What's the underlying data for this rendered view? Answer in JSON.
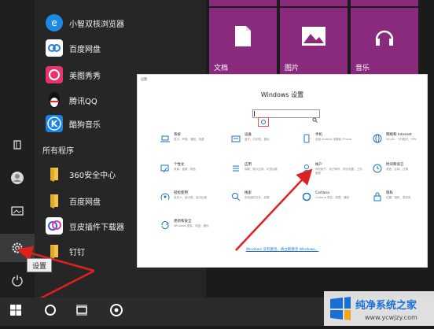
{
  "start_menu": {
    "apps_pinned": [
      {
        "label": "小智双核浏览器",
        "icon": "browser-icon",
        "color": "#1e88e5"
      },
      {
        "label": "百度网盘",
        "icon": "cloud-icon",
        "color": "#2d7be5"
      },
      {
        "label": "美图秀秀",
        "icon": "camera-icon",
        "color": "#e8336b"
      },
      {
        "label": "腾讯QQ",
        "icon": "qq-penguin-icon",
        "color": "#111111"
      },
      {
        "label": "酷狗音乐",
        "icon": "kugou-icon",
        "color": "#1a84e6"
      }
    ],
    "section_label": "所有程序",
    "apps_all": [
      {
        "label": "360安全中心",
        "icon": "folder-icon"
      },
      {
        "label": "百度网盘",
        "icon": "folder-icon"
      },
      {
        "label": "豆皮插件下载器",
        "icon": "plugin-icon"
      },
      {
        "label": "钉钉",
        "icon": "folder-icon"
      }
    ],
    "tiles": [
      {
        "label": "文档",
        "icon": "document-icon"
      },
      {
        "label": "图片",
        "icon": "picture-icon"
      },
      {
        "label": "音乐",
        "icon": "headphones-icon"
      }
    ],
    "tile_color": "#8a2a7c",
    "tooltip": "设置"
  },
  "settings_window": {
    "title_small": "设置",
    "title": "Windows 设置",
    "search_placeholder": "",
    "categories": [
      {
        "title": "系统",
        "desc": "显示、声音、通知、电源",
        "icon": "laptop-icon"
      },
      {
        "title": "设备",
        "desc": "蓝牙、打印机、鼠标",
        "icon": "keyboard-icon"
      },
      {
        "title": "手机",
        "desc": "连接 Android 设备和 iPhone",
        "icon": "phone-icon"
      },
      {
        "title": "网络和 Internet",
        "desc": "WLAN、飞行模式、VPN",
        "icon": "globe-icon"
      },
      {
        "title": "个性化",
        "desc": "背景、锁屏、颜色",
        "icon": "brush-icon"
      },
      {
        "title": "应用",
        "desc": "卸载、默认应用、可选功能",
        "icon": "apps-icon"
      },
      {
        "title": "帐户",
        "desc": "你的帐户、电子邮件、同步设置、工作、家庭",
        "icon": "person-icon"
      },
      {
        "title": "时间和语言",
        "desc": "语音、区域、日期",
        "icon": "clock-language-icon"
      },
      {
        "title": "轻松使用",
        "desc": "讲述人、放大镜、高对比度",
        "icon": "accessibility-icon"
      },
      {
        "title": "搜索",
        "desc": "查找我的文件、权限",
        "icon": "search-icon"
      },
      {
        "title": "Cortana",
        "desc": "Cortana 语言、权限、通知",
        "icon": "cortana-icon"
      },
      {
        "title": "隐私",
        "desc": "位置、相机、麦克风",
        "icon": "lock-icon"
      },
      {
        "title": "更新和安全",
        "desc": "Windows 更新、恢复、备份",
        "icon": "update-icon"
      }
    ],
    "activate_link": "Windows 没有激活。请立即激活 Windows。",
    "accent": "#1a73c8"
  },
  "watermark": {
    "title": "纯净系统之家",
    "url": "www.ycwjzy.com"
  },
  "arrow_color": "#e02020"
}
